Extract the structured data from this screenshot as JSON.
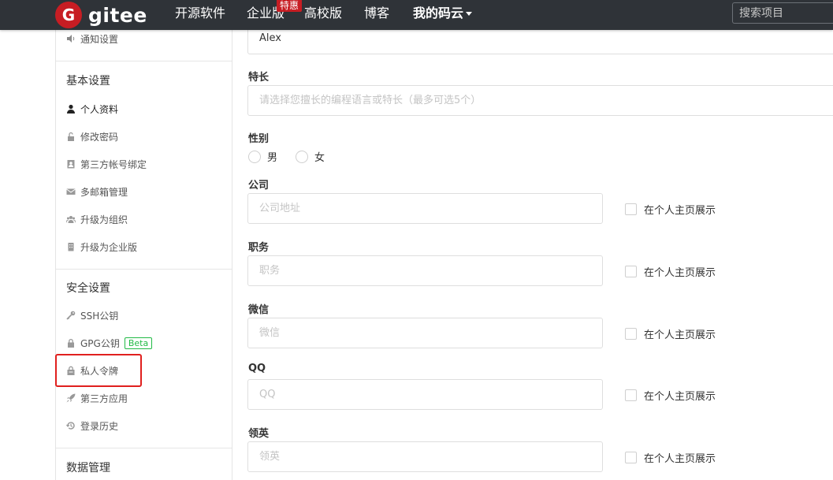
{
  "brand": {
    "logo_letter": "G",
    "name": "gitee"
  },
  "nav": {
    "items": [
      "开源软件",
      "企业版",
      "高校版",
      "博客",
      "我的码云"
    ],
    "special_badge": "特惠",
    "search_placeholder": "搜索项目"
  },
  "sidebar": {
    "top_item": "通知设置",
    "basic_heading": "基本设置",
    "basic_items": [
      "个人资料",
      "修改密码",
      "第三方帐号绑定",
      "多邮箱管理",
      "升级为组织",
      "升级为企业版"
    ],
    "security_heading": "安全设置",
    "security_items": [
      "SSH公钥",
      "GPG公钥",
      "私人令牌",
      "第三方应用",
      "登录历史"
    ],
    "beta_label": "Beta",
    "data_heading": "数据管理"
  },
  "form": {
    "name_value": "Alex",
    "specialty_label": "特长",
    "specialty_placeholder": "请选择您擅长的编程语言或特长（最多可选5个）",
    "gender_label": "性别",
    "gender_options": [
      "男",
      "女"
    ],
    "company_label": "公司",
    "company_placeholder": "公司地址",
    "position_label": "职务",
    "position_placeholder": "职务",
    "wechat_label": "微信",
    "wechat_placeholder": "微信",
    "qq_label": "QQ",
    "qq_placeholder": "QQ",
    "linkedin_label": "领英",
    "linkedin_placeholder": "领英",
    "show_on_profile": "在个人主页展示"
  },
  "colors": {
    "nav_bg": "#2f3338",
    "brand_red": "#c71d23",
    "beta_green": "#21ba45",
    "highlight": "#e0201e"
  }
}
